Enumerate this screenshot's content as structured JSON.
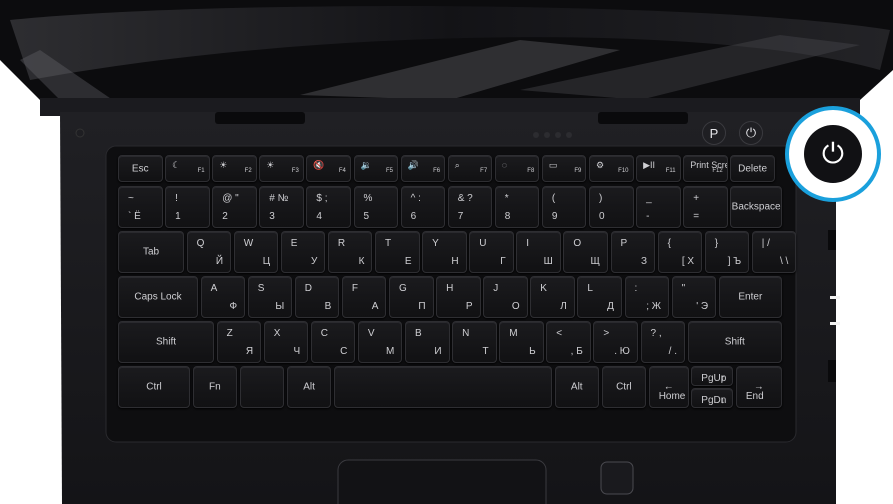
{
  "keyboard": {
    "function_row": [
      {
        "top": "Esc",
        "corner": ""
      },
      {
        "top": "☾",
        "corner": "F1"
      },
      {
        "top": "☀",
        "corner": "F2"
      },
      {
        "top": "☀",
        "corner": "F3"
      },
      {
        "top": "🔇",
        "corner": "F4"
      },
      {
        "top": "🔉",
        "corner": "F5"
      },
      {
        "top": "🔊",
        "corner": "F6"
      },
      {
        "top": "⌕",
        "corner": "F7"
      },
      {
        "top": "◌",
        "corner": "F8"
      },
      {
        "top": "▭",
        "corner": "F9"
      },
      {
        "top": "⚙",
        "corner": "F10"
      },
      {
        "top": "▶II",
        "corner": "F11"
      },
      {
        "top": "Print Screen",
        "corner": "F12"
      },
      {
        "top": "Delete",
        "corner": ""
      }
    ],
    "number_row": [
      {
        "t": "~",
        "b": "`  Ё",
        "r": ""
      },
      {
        "t": "!",
        "b": "1",
        "r": ""
      },
      {
        "t": "@  \"",
        "b": "2",
        "r": ""
      },
      {
        "t": "#  №",
        "b": "3",
        "r": ""
      },
      {
        "t": "$  ;",
        "b": "4",
        "r": ""
      },
      {
        "t": "%",
        "b": "5",
        "r": ""
      },
      {
        "t": "^  :",
        "b": "6",
        "r": ""
      },
      {
        "t": "&  ?",
        "b": "7",
        "r": ""
      },
      {
        "t": "*",
        "b": "8",
        "r": ""
      },
      {
        "t": "(",
        "b": "9",
        "r": ""
      },
      {
        "t": ")",
        "b": "0",
        "r": ""
      },
      {
        "t": "_",
        "b": "-",
        "r": ""
      },
      {
        "t": "+",
        "b": "=",
        "r": ""
      }
    ],
    "backspace": "Backspace",
    "tab": "Tab",
    "q_row": [
      {
        "t": "Q",
        "r": "Й"
      },
      {
        "t": "W",
        "r": "Ц"
      },
      {
        "t": "E",
        "r": "У"
      },
      {
        "t": "R",
        "r": "К"
      },
      {
        "t": "T",
        "r": "Е"
      },
      {
        "t": "Y",
        "r": "Н"
      },
      {
        "t": "U",
        "r": "Г"
      },
      {
        "t": "I",
        "r": "Ш"
      },
      {
        "t": "O",
        "r": "Щ"
      },
      {
        "t": "P",
        "r": "З"
      },
      {
        "t": "{",
        "r": "[  Х"
      },
      {
        "t": "}",
        "r": "]  Ъ"
      },
      {
        "t": "|  /",
        "r": "\\  \\"
      }
    ],
    "caps": "Caps Lock",
    "a_row": [
      {
        "t": "A",
        "r": "Ф"
      },
      {
        "t": "S",
        "r": "Ы"
      },
      {
        "t": "D",
        "r": "В"
      },
      {
        "t": "F",
        "r": "А"
      },
      {
        "t": "G",
        "r": "П"
      },
      {
        "t": "H",
        "r": "Р"
      },
      {
        "t": "J",
        "r": "О"
      },
      {
        "t": "K",
        "r": "Л"
      },
      {
        "t": "L",
        "r": "Д"
      },
      {
        "t": ":",
        "r": ";  Ж"
      },
      {
        "t": "\"",
        "r": "'  Э"
      }
    ],
    "enter": "Enter",
    "shift": "Shift",
    "z_row": [
      {
        "t": "Z",
        "r": "Я"
      },
      {
        "t": "X",
        "r": "Ч"
      },
      {
        "t": "C",
        "r": "С"
      },
      {
        "t": "V",
        "r": "М"
      },
      {
        "t": "B",
        "r": "И"
      },
      {
        "t": "N",
        "r": "Т"
      },
      {
        "t": "M",
        "r": "Ь"
      },
      {
        "t": "<",
        "r": ",  Б"
      },
      {
        "t": ">",
        "r": ".  Ю"
      },
      {
        "t": "?  ,",
        "r": "/  ."
      }
    ],
    "bottom": {
      "ctrl": "Ctrl",
      "fn": "Fn",
      "alt": "Alt",
      "alt_r": "Alt",
      "ctrl_r": "Ctrl",
      "left_arrow": "←",
      "home": "Home",
      "pgup": "PgUp",
      "up_arrow": "↑",
      "pgdn": "PgDn",
      "down_arrow": "↓",
      "right_arrow": "→",
      "end": "End"
    }
  },
  "buttons": {
    "p_label": "P",
    "power_small": "⏻",
    "power_big": "⏻"
  },
  "colors": {
    "highlight_ring": "#1aa0dc"
  }
}
